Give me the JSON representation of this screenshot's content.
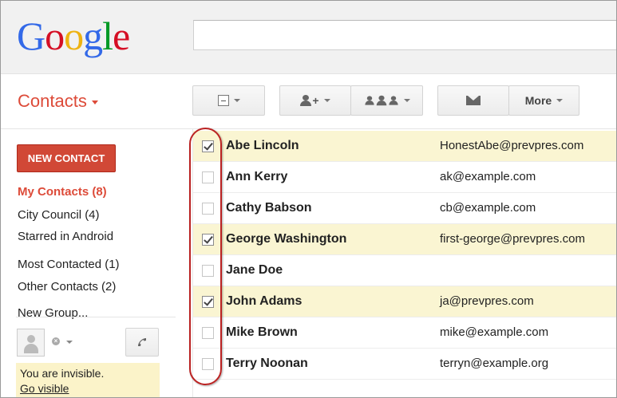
{
  "logo": {
    "text": "Google",
    "letters": [
      {
        "ch": "G",
        "color": "#3369e8"
      },
      {
        "ch": "o",
        "color": "#d50f25"
      },
      {
        "ch": "o",
        "color": "#eeb211"
      },
      {
        "ch": "g",
        "color": "#3369e8"
      },
      {
        "ch": "l",
        "color": "#009925"
      },
      {
        "ch": "e",
        "color": "#d50f25"
      }
    ]
  },
  "search": {
    "placeholder": ""
  },
  "app_menu": {
    "label": "Contacts",
    "color": "#dd4b39"
  },
  "toolbar": {
    "select_icon": "select-checkbox-icon",
    "add_to_contacts_icon": "add-person-icon",
    "groups_icon": "group-icon",
    "email_icon": "envelope-icon",
    "more_label": "More"
  },
  "sidebar": {
    "new_contact_label": "NEW CONTACT",
    "items": [
      {
        "label": "My Contacts (8)",
        "active": true
      },
      {
        "label": "City Council (4)",
        "active": false
      },
      {
        "label": "Starred in Android",
        "active": false
      },
      {
        "label": "Most Contacted (1)",
        "active": false
      },
      {
        "label": "Other Contacts (2)",
        "active": false
      },
      {
        "label": "New Group...",
        "active": false
      }
    ],
    "chat": {
      "status_text": "You are invisible.",
      "go_visible_label": "Go visible"
    }
  },
  "contacts": [
    {
      "name": "Abe Lincoln",
      "email": "HonestAbe@prevpres.com",
      "checked": true
    },
    {
      "name": "Ann Kerry",
      "email": "ak@example.com",
      "checked": false
    },
    {
      "name": "Cathy Babson",
      "email": "cb@example.com",
      "checked": false
    },
    {
      "name": "George Washington",
      "email": "first-george@prevpres.com",
      "checked": true
    },
    {
      "name": "Jane Doe",
      "email": "",
      "checked": false
    },
    {
      "name": "John Adams",
      "email": "ja@prevpres.com",
      "checked": true
    },
    {
      "name": "Mike Brown",
      "email": "mike@example.com",
      "checked": false
    },
    {
      "name": "Terry Noonan",
      "email": "terryn@example.org",
      "checked": false
    }
  ],
  "colors": {
    "accent_red": "#dd4b39",
    "button_red": "#d14836",
    "selected_row": "#faf5d2",
    "annotation_oval": "#bb2222"
  }
}
